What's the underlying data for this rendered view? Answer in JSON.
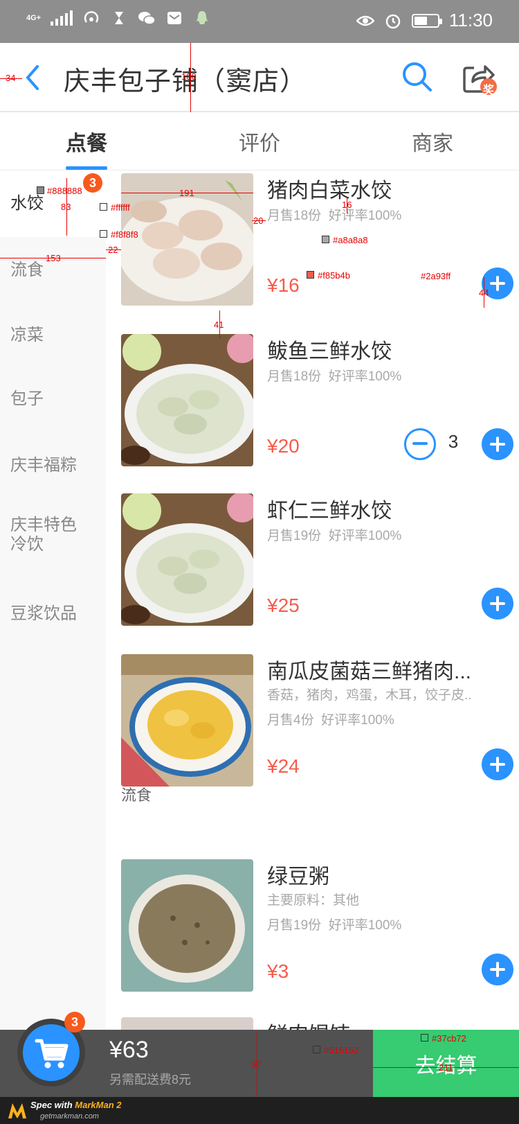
{
  "status_bar": {
    "network": "4G+",
    "signal_sub": "1",
    "time": "11:30",
    "battery_level": 0.55
  },
  "header": {
    "title": "庆丰包子铺（窦店）",
    "share_badge": "奖"
  },
  "tabs": [
    {
      "label": "点餐",
      "active": true
    },
    {
      "label": "评价",
      "active": false
    },
    {
      "label": "商家",
      "active": false
    }
  ],
  "categories": [
    {
      "label": "水饺",
      "badge": "3",
      "active": true
    },
    {
      "label": "流食"
    },
    {
      "label": "凉菜"
    },
    {
      "label": "包子"
    },
    {
      "label": "庆丰福粽"
    },
    {
      "label": "庆丰特色冷饮"
    },
    {
      "label": "豆浆饮品"
    }
  ],
  "menu": {
    "items": [
      {
        "name": "猪肉白菜水饺",
        "sales": "月售18份",
        "rating": "好评率100%",
        "price": "¥16"
      },
      {
        "name": "鲅鱼三鲜水饺",
        "sales": "月售18份",
        "rating": "好评率100%",
        "price": "¥20",
        "quantity": "3"
      },
      {
        "name": "虾仁三鲜水饺",
        "sales": "月售19份",
        "rating": "好评率100%",
        "price": "¥25"
      },
      {
        "name": "南瓜皮菌菇三鲜猪肉...",
        "ingredients": "香菇，猪肉，鸡蛋，木耳，饺子皮..",
        "sales": "月售4份",
        "rating": "好评率100%",
        "price": "¥24"
      },
      {
        "name": "绿豆粥",
        "ingredients": "主要原料：其他",
        "sales": "月售19份",
        "rating": "好评率100%",
        "price": "¥3"
      },
      {
        "name": "鲜肉馄饨"
      }
    ],
    "section_liushi": "流食"
  },
  "cart": {
    "badge": "3",
    "total": "¥63",
    "delivery_note": "另需配送费8元",
    "checkout_label": "去结算"
  },
  "footer": {
    "prefix": "Spec with ",
    "brand": "MarkMan 2",
    "url": "getmarkman.com"
  },
  "annotations": {
    "d34": "34",
    "d100": "100",
    "d191": "191",
    "d16": "16",
    "d83": "83",
    "d20": "20",
    "d22": "22",
    "d153": "153",
    "d41": "41",
    "d44": "44",
    "d97": "97",
    "d211": "211",
    "c888888": "#888888",
    "cffffff": "#ffffff",
    "cf8f8f8": "#f8f8f8",
    "ca8a8a8": "#a8a8a8",
    "cf85b4b": "#f85b4b",
    "c2a93ff": "#2a93ff",
    "c515152": "#515152",
    "c37cb72": "#37cb72"
  },
  "colors": {
    "accent": "#2a93ff",
    "price": "#f85b4b",
    "checkout": "#37cb72",
    "cart_bar": "#515152",
    "sidebar_bg": "#f8f8f8",
    "muted_text": "#a8a8a8",
    "category_text": "#888888"
  }
}
